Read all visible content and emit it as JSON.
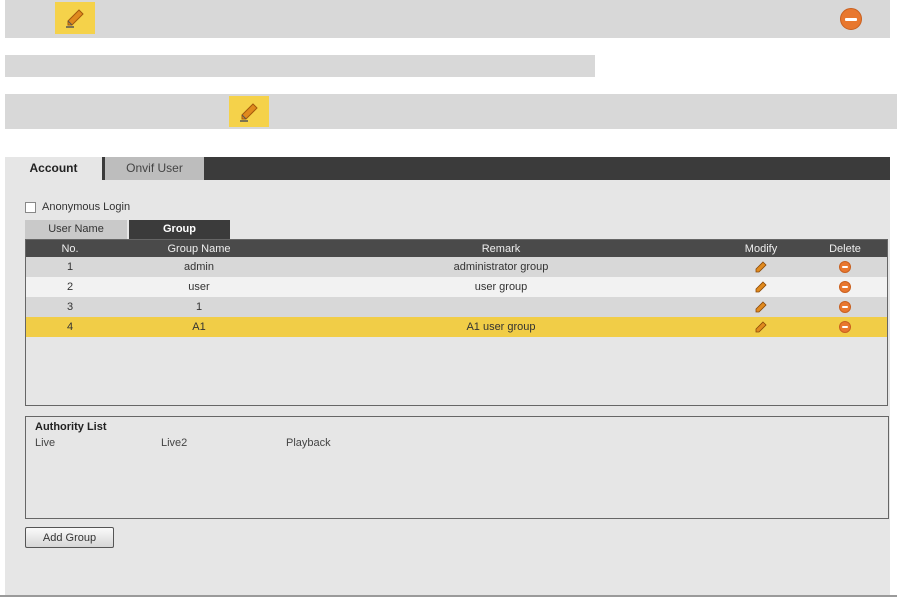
{
  "legend": {
    "icons": [
      "pencil-icon",
      "delete-icon"
    ]
  },
  "tabs": {
    "account": "Account",
    "onvif": "Onvif User"
  },
  "anonymous_login": "Anonymous Login",
  "subtabs": {
    "user_name": "User Name",
    "group": "Group"
  },
  "table": {
    "headers": {
      "no": "No.",
      "group_name": "Group Name",
      "remark": "Remark",
      "modify": "Modify",
      "delete": "Delete"
    },
    "rows": [
      {
        "no": "1",
        "group_name": "admin",
        "remark": "administrator group"
      },
      {
        "no": "2",
        "group_name": "user",
        "remark": "user group"
      },
      {
        "no": "3",
        "group_name": "1",
        "remark": ""
      },
      {
        "no": "4",
        "group_name": "A1",
        "remark": "A1 user group"
      }
    ],
    "selected_row": 4
  },
  "authority": {
    "title": "Authority List",
    "items": [
      "Live",
      "Live2",
      "Playback"
    ]
  },
  "add_group_label": "Add Group",
  "colors": {
    "highlight": "#f1cd47",
    "delete": "#e8772e",
    "header": "#4a4a4a"
  }
}
